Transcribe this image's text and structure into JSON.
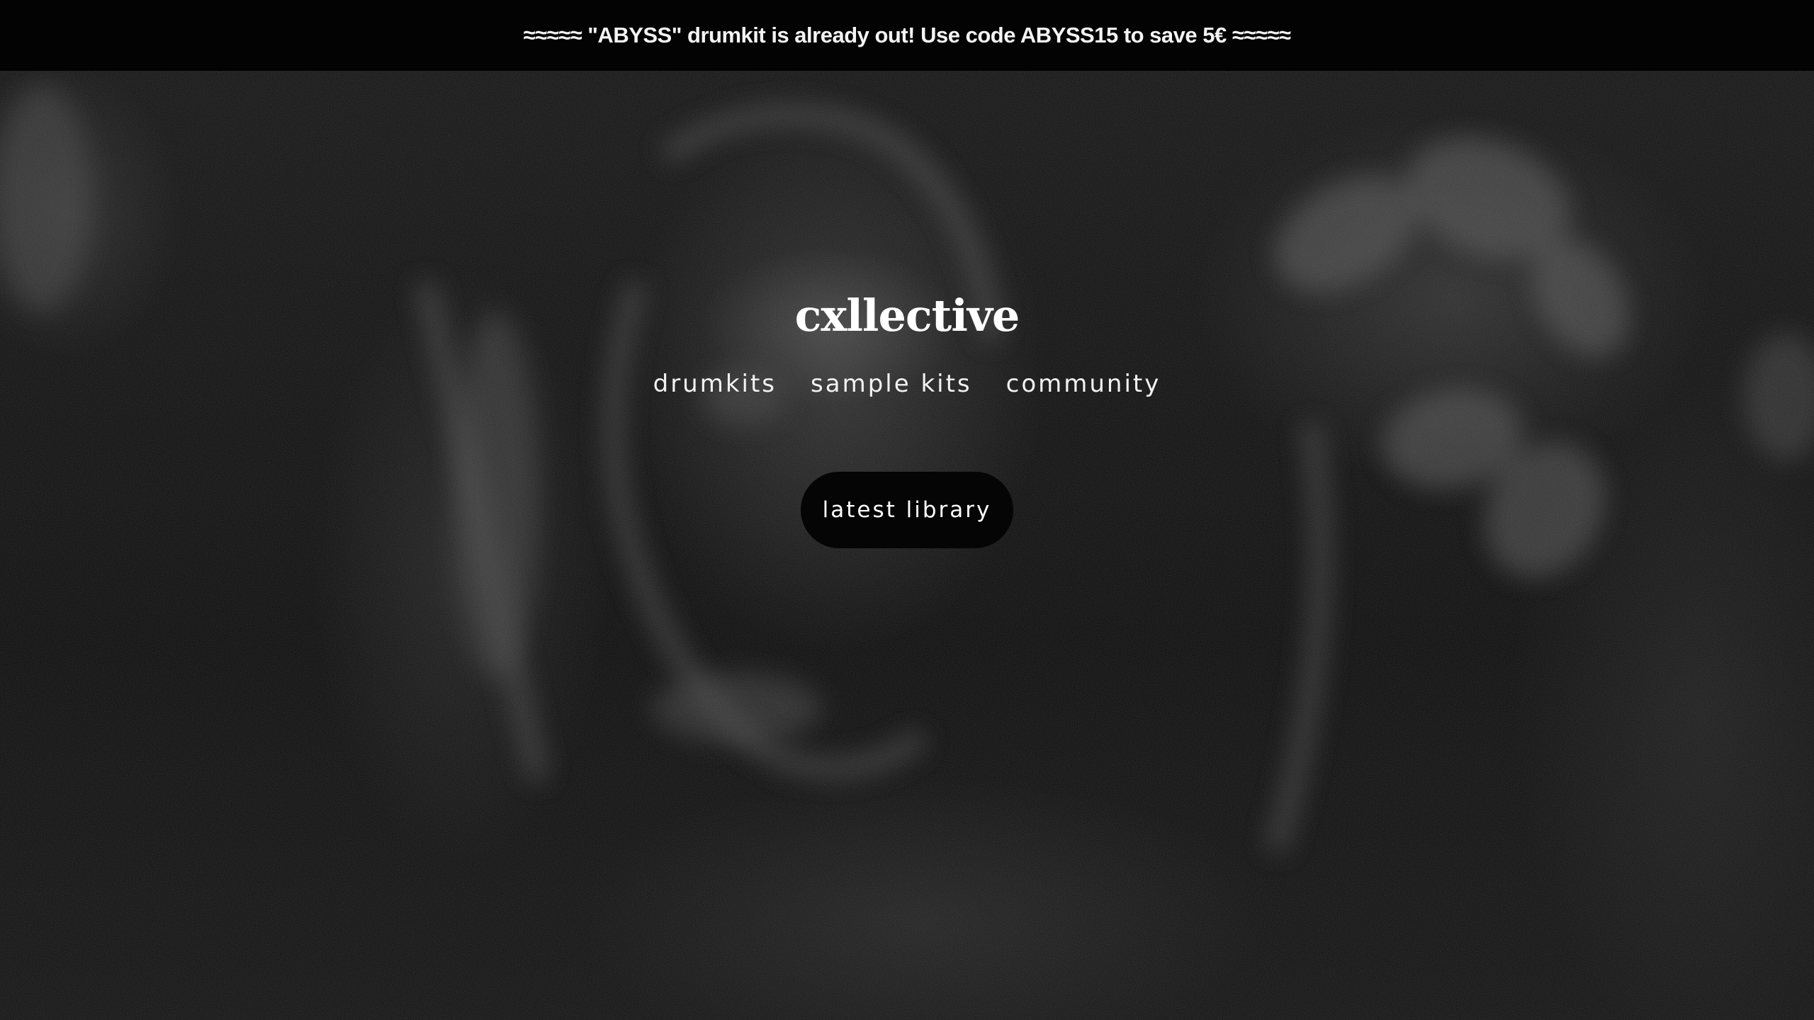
{
  "announcement": {
    "text": "≈≈≈≈≈ \"ABYSS\" drumkit is already out! Use code ABYSS15 to save 5€ ≈≈≈≈≈"
  },
  "brand": {
    "title": "cxllective"
  },
  "nav": {
    "items": [
      {
        "label": "drumkits"
      },
      {
        "label": "sample kits"
      },
      {
        "label": "community"
      }
    ]
  },
  "cta": {
    "label": "latest library"
  },
  "colors": {
    "background": "#000000",
    "text": "#ffffff",
    "button_bg": "#050505"
  }
}
